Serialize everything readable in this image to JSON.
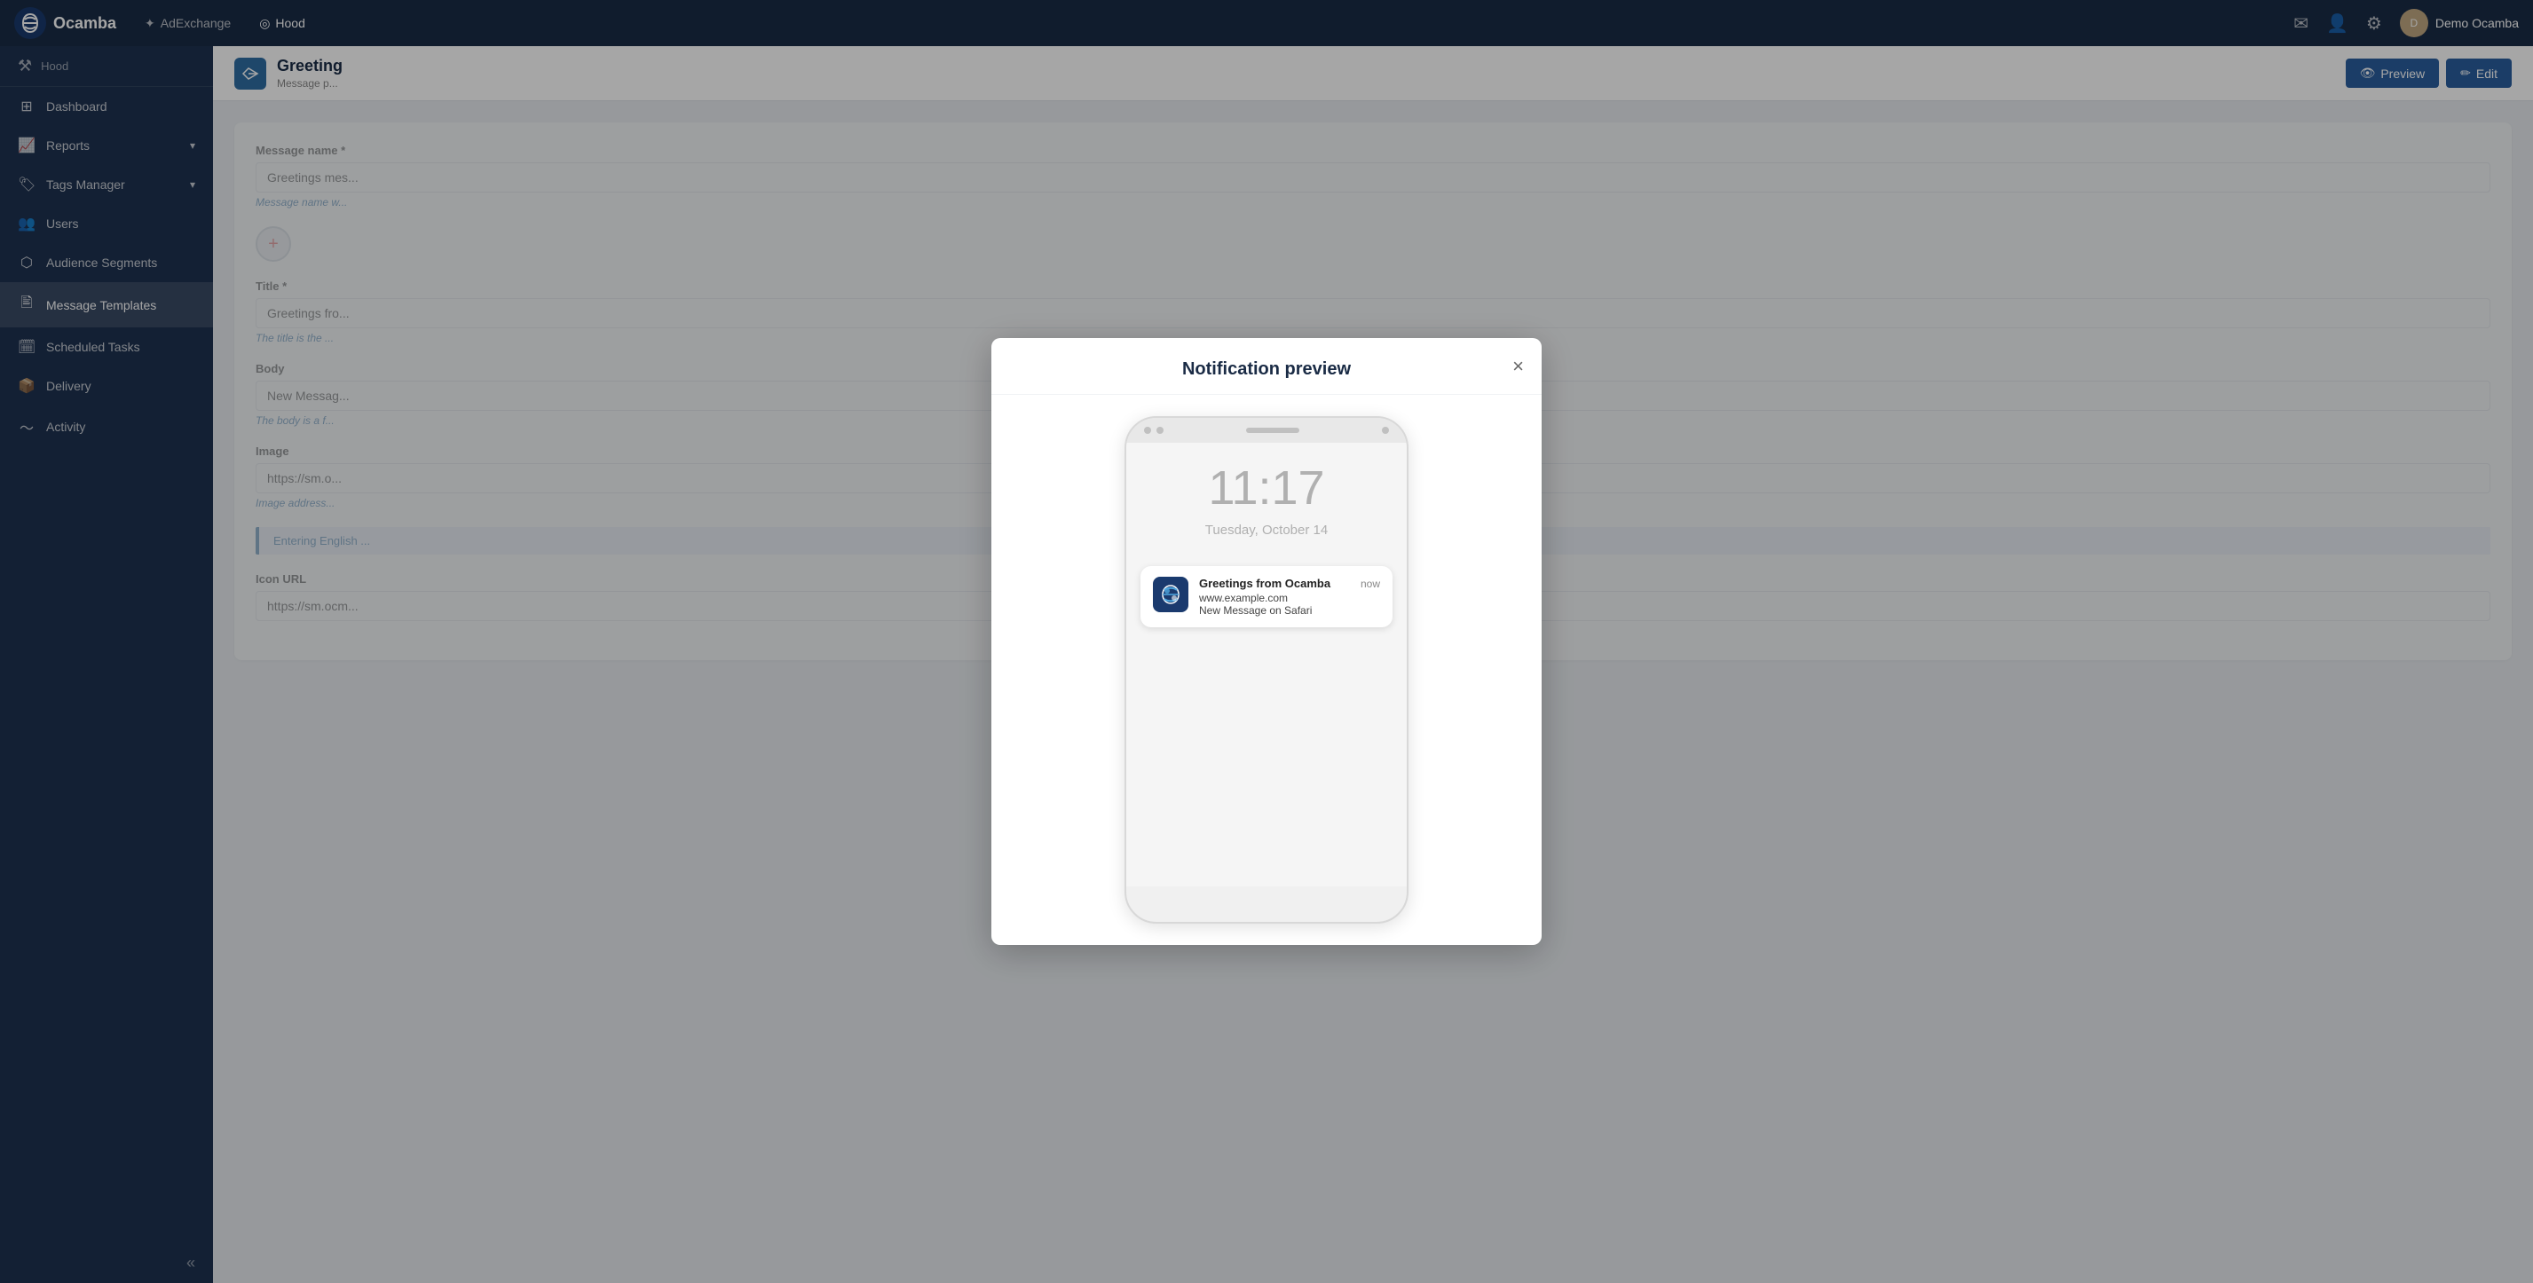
{
  "app": {
    "name": "Ocamba",
    "user": "Demo Ocamba"
  },
  "topnav": {
    "logo": "Ocamba",
    "links": [
      "AdExchange",
      "Hood"
    ],
    "icons": [
      "mail-icon",
      "user-icon",
      "gear-icon"
    ]
  },
  "sidebar": {
    "section_icon": "wrench-icon",
    "section_title": "Hood",
    "items": [
      {
        "id": "dashboard",
        "label": "Dashboard",
        "icon": "dashboard-icon",
        "active": false
      },
      {
        "id": "reports",
        "label": "Reports",
        "icon": "reports-icon",
        "has_chevron": true,
        "active": false
      },
      {
        "id": "tags-manager",
        "label": "Tags Manager",
        "icon": "tags-icon",
        "has_chevron": true,
        "active": false
      },
      {
        "id": "users",
        "label": "Users",
        "icon": "users-icon",
        "active": false
      },
      {
        "id": "audience-segments",
        "label": "Audience Segments",
        "icon": "segments-icon",
        "active": false
      },
      {
        "id": "message-templates",
        "label": "Message Templates",
        "icon": "message-icon",
        "active": true
      },
      {
        "id": "scheduled-tasks",
        "label": "Scheduled Tasks",
        "icon": "tasks-icon",
        "active": false
      },
      {
        "id": "delivery",
        "label": "Delivery",
        "icon": "delivery-icon",
        "active": false
      },
      {
        "id": "activity",
        "label": "Activity",
        "icon": "activity-icon",
        "active": false
      }
    ],
    "collapse_label": "«"
  },
  "main_header": {
    "icon": "send-icon",
    "title": "Greeting",
    "subtitle": "Message p...",
    "actions": {
      "preview_label": "Preview",
      "edit_label": "Edit"
    }
  },
  "form": {
    "message_name_label": "Message name *",
    "message_name_value": "Greetings mes...",
    "message_name_hint": "Message name w...",
    "title_label": "Title *",
    "title_value": "Greetings fro...",
    "title_hint": "The title is the ...",
    "body_label": "Body",
    "body_value": "New Messag...",
    "body_hint": "The body is a f...",
    "image_label": "Image",
    "image_value": "https://sm.o...",
    "image_hint": "Image address...",
    "section_badge": "Entering English ...",
    "icon_url_label": "Icon URL",
    "icon_url_value": "https://sm.ocm..."
  },
  "modal": {
    "title": "Notification preview",
    "close_label": "×",
    "phone": {
      "time": "11:17",
      "date": "Tuesday, October 14",
      "notification": {
        "app_name": "Greetings from Ocamba",
        "url": "www.example.com",
        "body": "New Message on Safari",
        "time": "now"
      }
    }
  }
}
